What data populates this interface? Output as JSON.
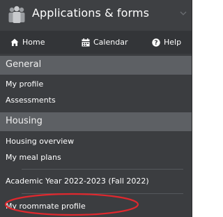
{
  "header": {
    "title": "Applications & forms",
    "icon": "people-icon"
  },
  "navbar": {
    "home_label": "Home",
    "calendar_label": "Calendar",
    "help_label": "Help"
  },
  "sections": {
    "general": {
      "title": "General",
      "items": [
        "My profile",
        "Assessments"
      ]
    },
    "housing": {
      "title": "Housing",
      "items": [
        "Housing overview",
        "My meal plans",
        "Academic Year 2022-2023 (Fall 2022)",
        "My roommate profile"
      ]
    }
  },
  "colors": {
    "panel_bg": "#3b3d40",
    "section_bg": "#5d6064",
    "highlight_ellipse": "#e0282e"
  }
}
